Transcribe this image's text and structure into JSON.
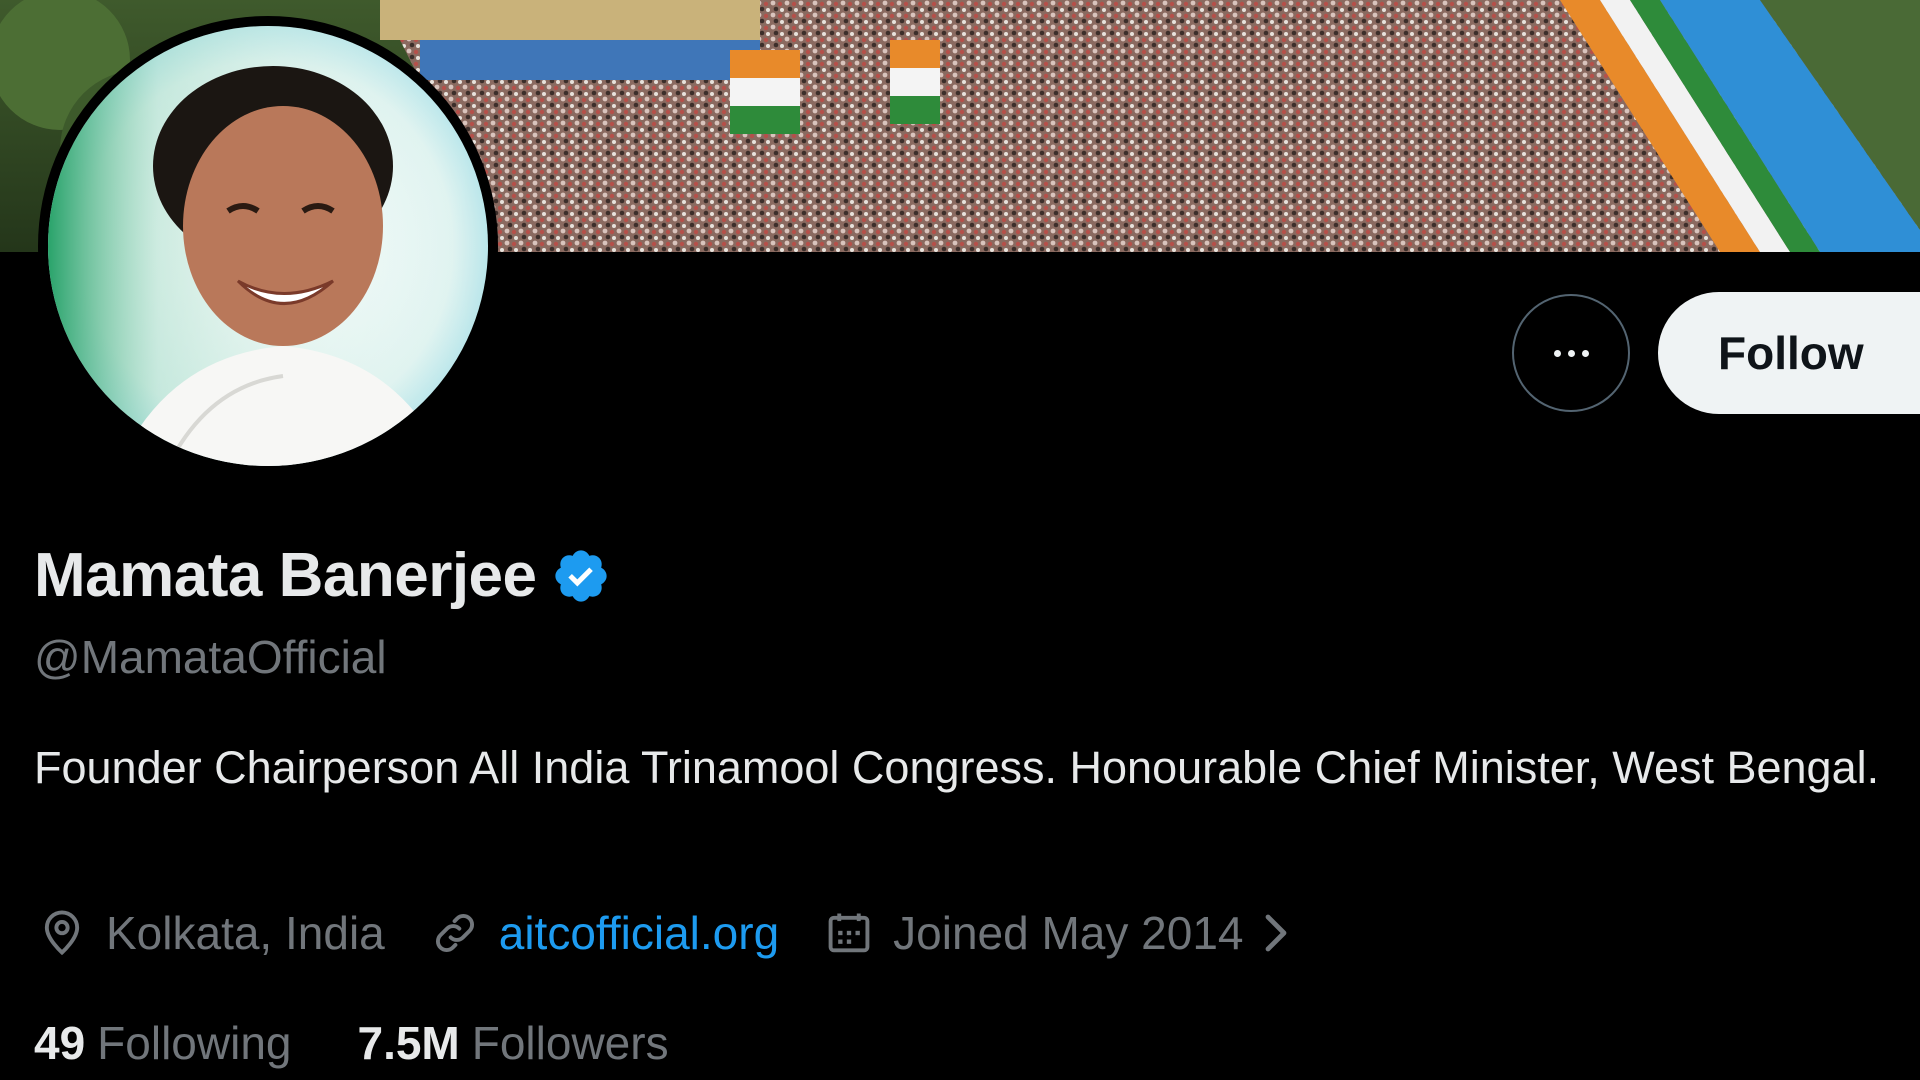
{
  "profile": {
    "display_name": "Mamata Banerjee",
    "handle": "@MamataOfficial",
    "bio": "Founder Chairperson All India Trinamool Congress. Honourable Chief Minister, West Bengal.",
    "verified": true
  },
  "actions": {
    "follow_label": "Follow"
  },
  "meta": {
    "location": "Kolkata, India",
    "website": "aitcofficial.org",
    "joined": "Joined May 2014"
  },
  "stats": {
    "following_count": "49",
    "following_label": "Following",
    "followers_count": "7.5M",
    "followers_label": "Followers"
  },
  "colors": {
    "background": "#000000",
    "text_primary": "#e7e9ea",
    "text_secondary": "#71767b",
    "link": "#1d9bf0",
    "verified": "#1d9bf0",
    "follow_button_bg": "#eff3f4"
  },
  "icons": {
    "verified": "verified-badge-icon",
    "more": "more-horizontal-icon",
    "location": "location-pin-icon",
    "link": "link-icon",
    "calendar": "calendar-icon",
    "chevron": "chevron-right-icon"
  }
}
